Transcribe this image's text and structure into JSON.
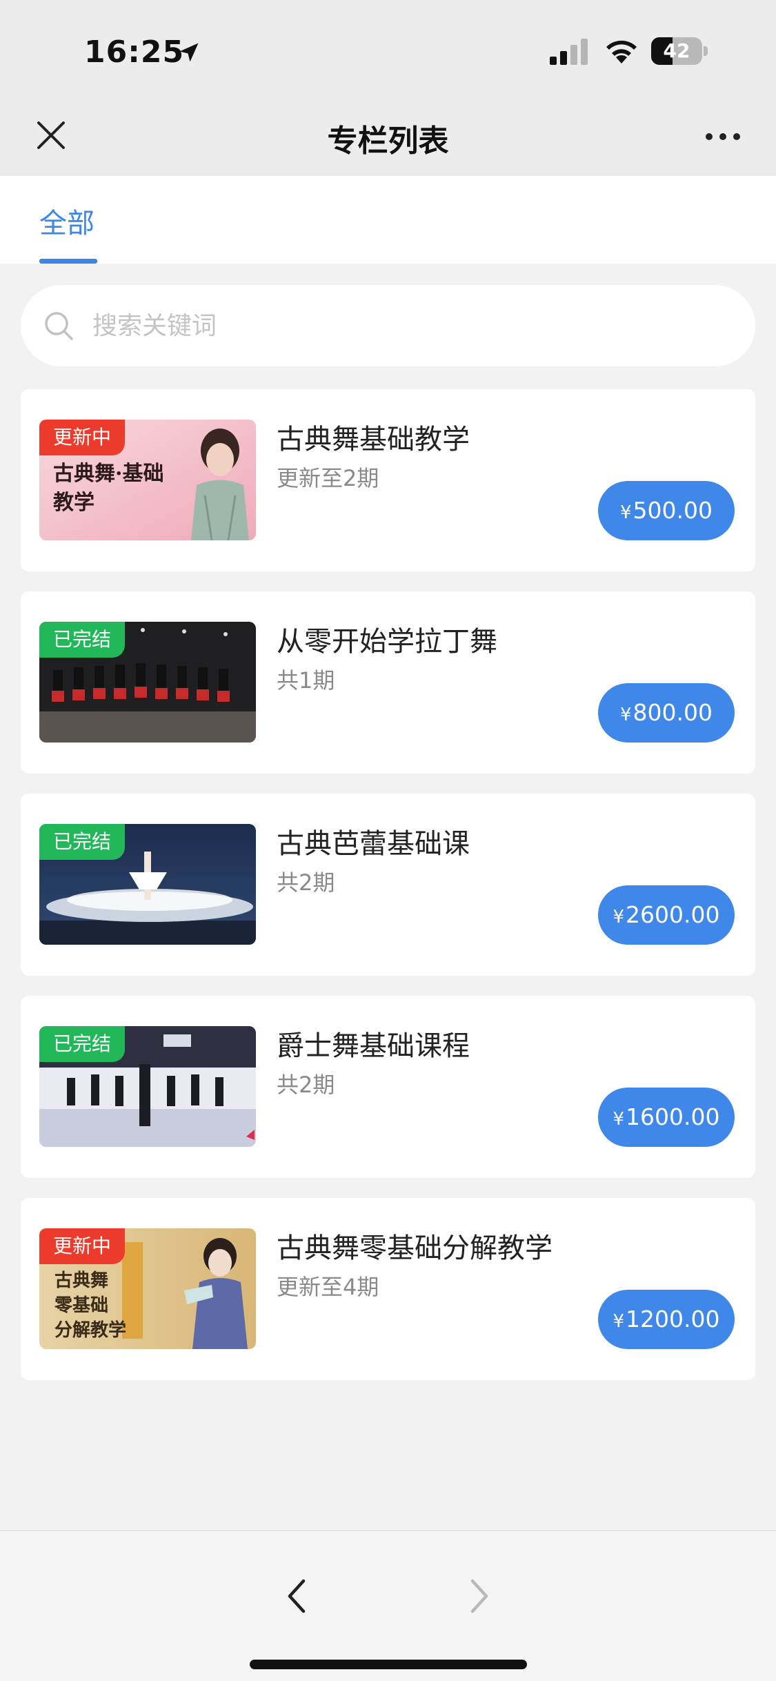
{
  "status_bar": {
    "time": "16:25",
    "battery_level": "42"
  },
  "nav": {
    "title": "专栏列表"
  },
  "tabs": [
    {
      "label": "全部",
      "active": true
    }
  ],
  "search": {
    "placeholder": "搜索关键词",
    "value": ""
  },
  "courses": [
    {
      "badge": "更新中",
      "badge_type": "update",
      "title": "古典舞基础教学",
      "subtitle": "更新至2期",
      "currency": "¥",
      "price": "500.00",
      "thumb_text": "古典舞·基础教学"
    },
    {
      "badge": "已完结",
      "badge_type": "done",
      "title": "从零开始学拉丁舞",
      "subtitle": "共1期",
      "currency": "¥",
      "price": "800.00"
    },
    {
      "badge": "已完结",
      "badge_type": "done",
      "title": "古典芭蕾基础课",
      "subtitle": "共2期",
      "currency": "¥",
      "price": "2600.00"
    },
    {
      "badge": "已完结",
      "badge_type": "done",
      "title": "爵士舞基础课程",
      "subtitle": "共2期",
      "currency": "¥",
      "price": "1600.00"
    },
    {
      "badge": "更新中",
      "badge_type": "update",
      "title": "古典舞零基础分解教学",
      "subtitle": "更新至4期",
      "currency": "¥",
      "price": "1200.00",
      "thumb_text": "古典舞 零基础 分解教学"
    }
  ],
  "colors": {
    "accent": "#3d86e8",
    "badge_update": "#ec3b2d",
    "badge_done": "#22b85a"
  }
}
